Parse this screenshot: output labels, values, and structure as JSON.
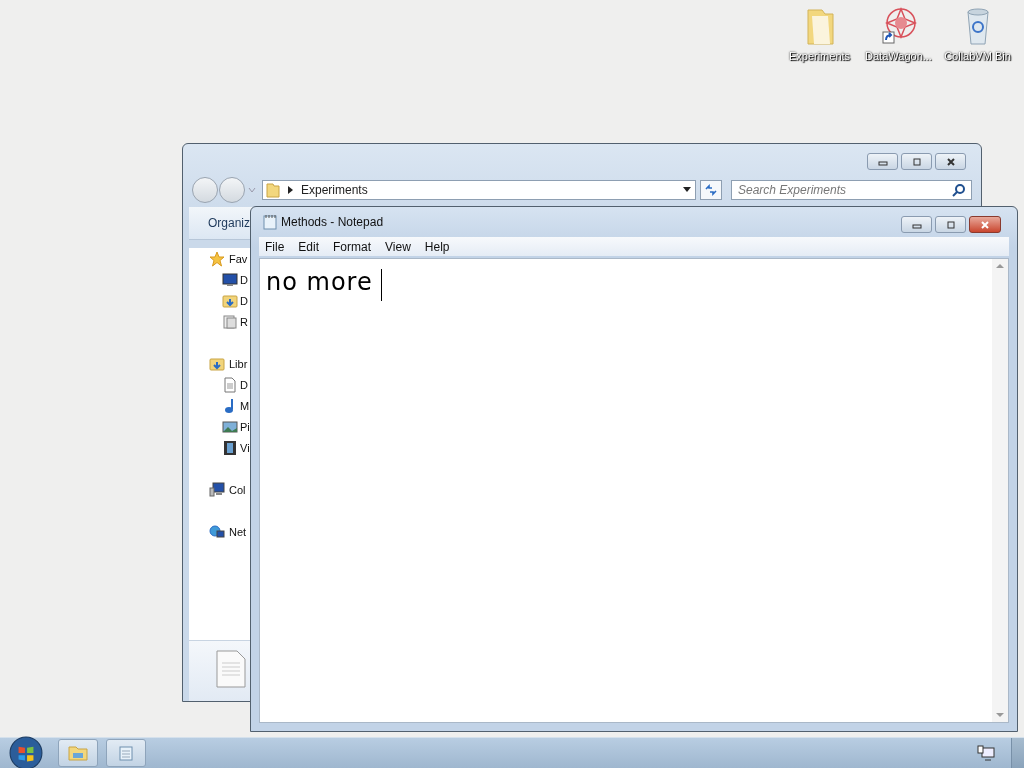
{
  "desktop_icons": [
    {
      "label": "Experiments",
      "kind": "folder"
    },
    {
      "label": "DataWagon...",
      "kind": "shortcut"
    },
    {
      "label": "CollabVM Bin",
      "kind": "bin"
    }
  ],
  "explorer": {
    "address": "Experiments",
    "search": {
      "placeholder": "Search Experiments"
    },
    "toolbar": [
      "Organiz"
    ],
    "nav": [
      {
        "label": "Fav",
        "kind": "favorites",
        "children": [
          {
            "label": "D",
            "kind": "desktop"
          },
          {
            "label": "D",
            "kind": "downloads"
          },
          {
            "label": "R",
            "kind": "recent"
          }
        ]
      },
      {
        "label": "Libr",
        "kind": "libraries",
        "children": [
          {
            "label": "D",
            "kind": "documents"
          },
          {
            "label": "M",
            "kind": "music"
          },
          {
            "label": "Pi",
            "kind": "pictures"
          },
          {
            "label": "Vi",
            "kind": "videos"
          }
        ]
      },
      {
        "label": "Col",
        "kind": "computer"
      },
      {
        "label": "Net",
        "kind": "network"
      }
    ]
  },
  "notepad": {
    "title": "Methods - Notepad",
    "menu": [
      "File",
      "Edit",
      "Format",
      "View",
      "Help"
    ],
    "text": "no more"
  },
  "taskbar": {
    "buttons": [
      {
        "kind": "explorer"
      },
      {
        "kind": "notepad"
      }
    ]
  }
}
